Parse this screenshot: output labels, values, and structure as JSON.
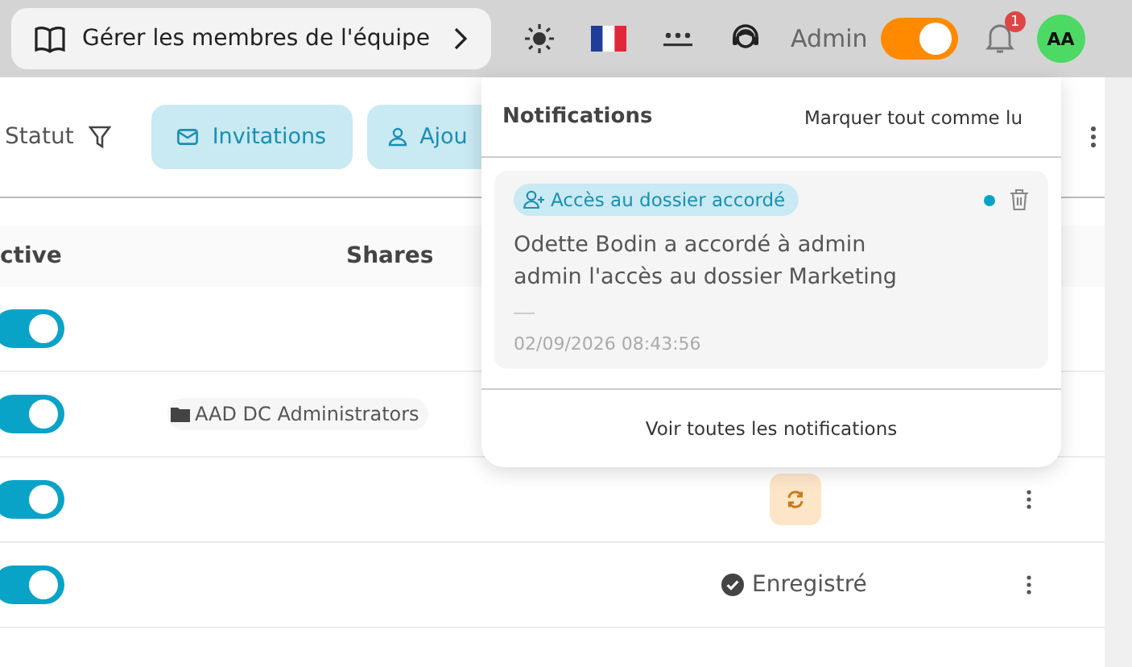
{
  "topbar": {
    "breadcrumb": "Gérer les membres de l'équipe",
    "user_label": "Admin",
    "admin_mode_on": true,
    "notification_count": "1",
    "avatar": "AA"
  },
  "toolbar": {
    "filter_label": "Statut",
    "buttons": [
      "Invitations",
      "Ajou"
    ]
  },
  "table": {
    "columns": [
      "ctive",
      "Shares"
    ],
    "rows": [
      {
        "active": true,
        "share": null,
        "status": {
          "kind": "none"
        }
      },
      {
        "active": true,
        "share": "AAD DC Administrators",
        "status": {
          "kind": "none"
        }
      },
      {
        "active": true,
        "share": null,
        "status": {
          "kind": "syncing"
        }
      },
      {
        "active": true,
        "share": null,
        "status": {
          "kind": "registered",
          "label": "Enregistré"
        }
      }
    ]
  },
  "notifications": {
    "title": "Notifications",
    "mark_all": "Marquer tout comme lu",
    "items": [
      {
        "tag": "Accès au dossier accordé",
        "message": "Odette Bodin a accordé à admin admin l'accès au dossier Marketing",
        "timestamp": "02/09/2026 08:43:56",
        "unread": true
      }
    ],
    "footer": "Voir toutes les notifications"
  }
}
